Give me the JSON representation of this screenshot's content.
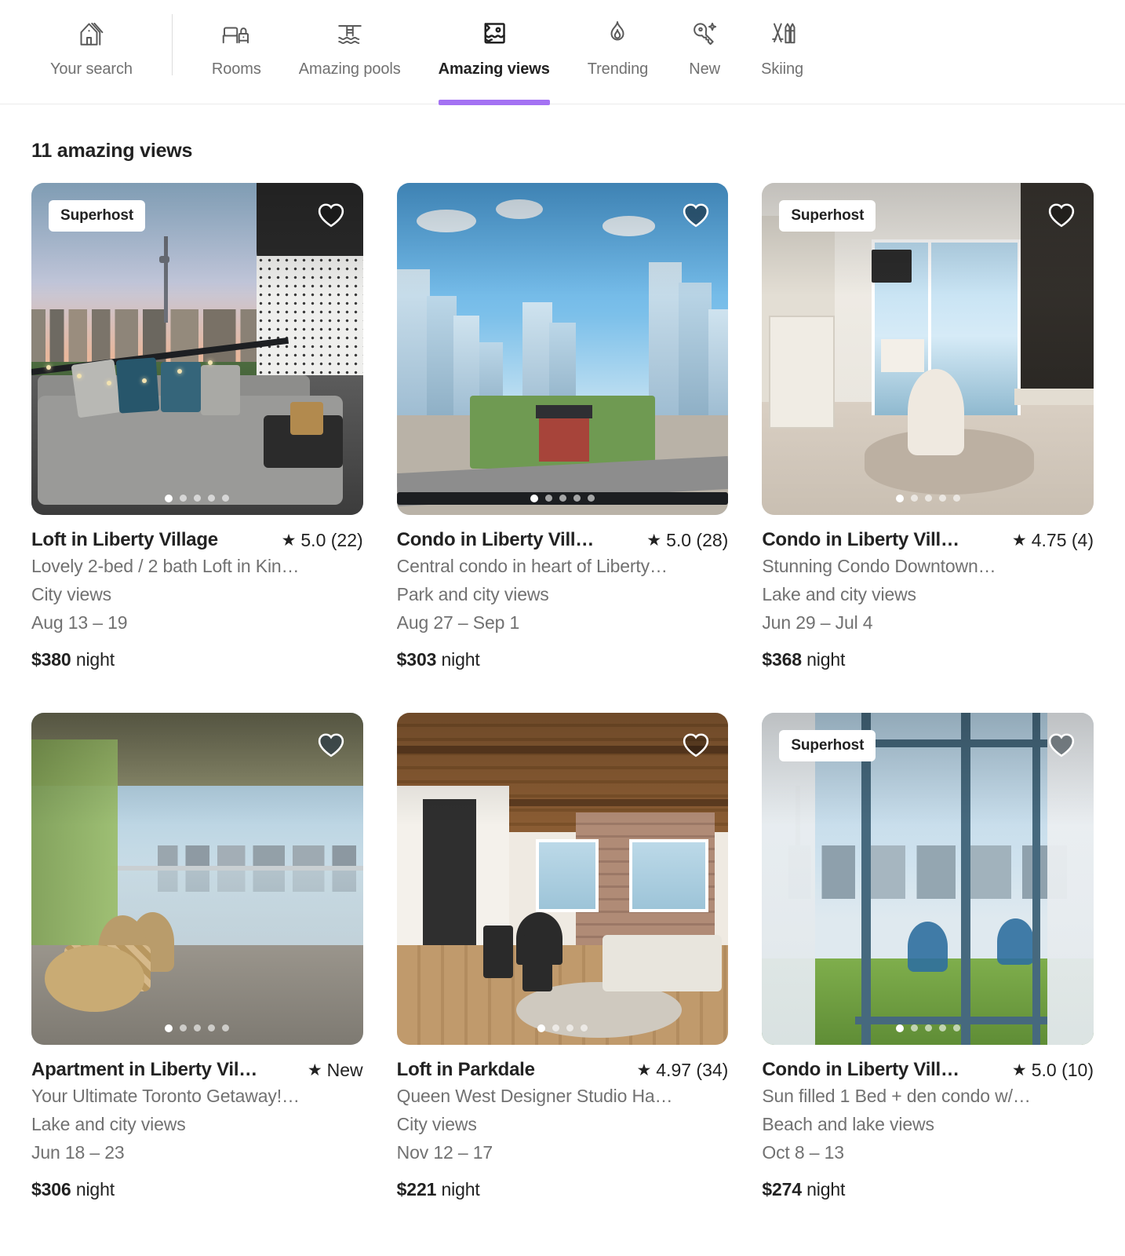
{
  "nav": {
    "tabs": [
      {
        "label": "Your search",
        "icon": "house-icon",
        "active": false
      },
      {
        "label": "Rooms",
        "icon": "bed-icon",
        "active": false
      },
      {
        "label": "Amazing pools",
        "icon": "pool-icon",
        "active": false
      },
      {
        "label": "Amazing views",
        "icon": "framed-view-icon",
        "active": true
      },
      {
        "label": "Trending",
        "icon": "flame-icon",
        "active": false
      },
      {
        "label": "New",
        "icon": "key-sparkle-icon",
        "active": false
      },
      {
        "label": "Skiing",
        "icon": "skis-icon",
        "active": false
      }
    ],
    "active_underline_color": "#A472F3"
  },
  "results": {
    "heading": "11 amazing views",
    "count": 11
  },
  "labels": {
    "superhost": "Superhost",
    "night_suffix": "night",
    "star_glyph": "★"
  },
  "listings": [
    {
      "title": "Loft in Liberty Village",
      "rating": "5.0 (22)",
      "subtitle": "Lovely 2-bed / 2 bath Loft in Kin…",
      "views": "City views",
      "dates": "Aug 13 – 19",
      "price": "$380",
      "night": "night",
      "superhost": true,
      "favorited": false,
      "dots": 5,
      "active_dot": 0
    },
    {
      "title": "Condo in Liberty Vill…",
      "rating": "5.0 (28)",
      "subtitle": "Central condo in heart of Liberty…",
      "views": "Park and city views",
      "dates": "Aug 27 – Sep 1",
      "price": "$303",
      "night": "night",
      "superhost": false,
      "favorited": true,
      "dots": 5,
      "active_dot": 0
    },
    {
      "title": "Condo in Liberty Vill…",
      "rating": "4.75 (4)",
      "subtitle": "Stunning Condo Downtown…",
      "views": "Lake and city views",
      "dates": "Jun 29 – Jul 4",
      "price": "$368",
      "night": "night",
      "superhost": true,
      "favorited": false,
      "dots": 5,
      "active_dot": 0
    },
    {
      "title": "Apartment in Liberty Vil…",
      "rating": "New",
      "subtitle": "Your Ultimate Toronto Getaway!…",
      "views": "Lake and city views",
      "dates": "Jun 18 – 23",
      "price": "$306",
      "night": "night",
      "superhost": false,
      "favorited": true,
      "dots": 5,
      "active_dot": 0
    },
    {
      "title": "Loft in Parkdale",
      "rating": "4.97 (34)",
      "subtitle": "Queen West Designer Studio Ha…",
      "views": "City views",
      "dates": "Nov 12 – 17",
      "price": "$221",
      "night": "night",
      "superhost": false,
      "favorited": false,
      "dots": 4,
      "active_dot": 0
    },
    {
      "title": "Condo in Liberty Vill…",
      "rating": "5.0 (10)",
      "subtitle": "Sun filled 1 Bed + den condo w/…",
      "views": "Beach and lake views",
      "dates": "Oct 8 – 13",
      "price": "$274",
      "night": "night",
      "superhost": true,
      "favorited": true,
      "dots": 5,
      "active_dot": 0
    }
  ]
}
